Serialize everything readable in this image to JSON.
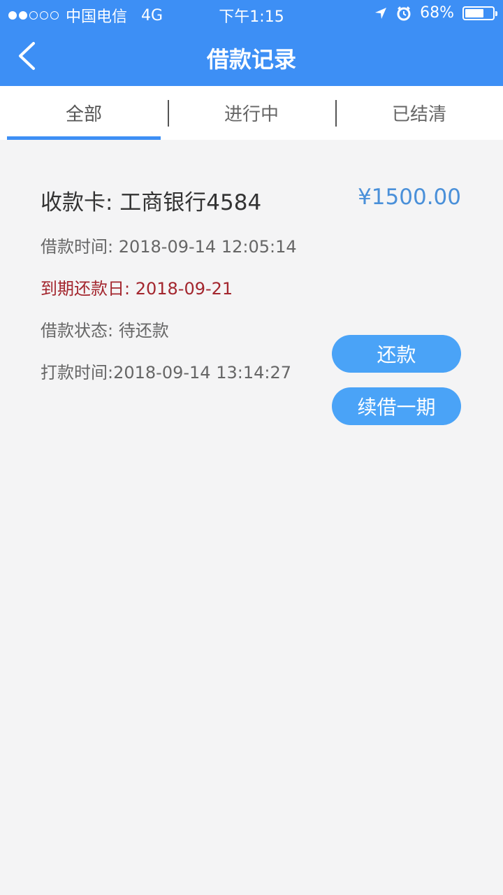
{
  "status_bar": {
    "carrier": "中国电信",
    "network": "4G",
    "time": "下午1:15",
    "battery": "68%",
    "battery_level": 0.68
  },
  "nav": {
    "title": "借款记录"
  },
  "tabs": [
    {
      "label": "全部",
      "active": true
    },
    {
      "label": "进行中",
      "active": false
    },
    {
      "label": "已结清",
      "active": false
    }
  ],
  "record": {
    "card": "收款卡: 工商银行4584",
    "amount": "¥1500.00",
    "loan_time": "借款时间: 2018-09-14  12:05:14",
    "due_date": "到期还款日: 2018-09-21",
    "status": "借款状态: 待还款",
    "transfer_time": "打款时间:2018-09-14  13:14:27",
    "repay_button": "还款",
    "renew_button": "续借一期"
  },
  "colors": {
    "accent": "#3d8ff5",
    "button": "#4aa3f7",
    "amount": "#4a90d9",
    "due": "#a3262e"
  }
}
